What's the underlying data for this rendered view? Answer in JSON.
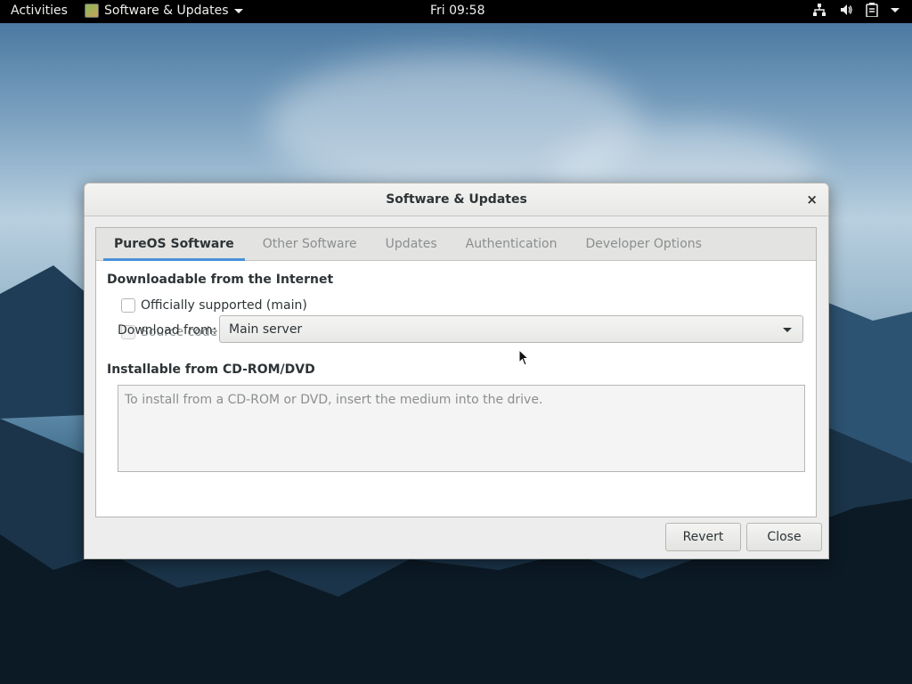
{
  "topbar": {
    "activities": "Activities",
    "app_menu": "Software & Updates",
    "clock": "Fri 09:58",
    "tray_icons": [
      "network-icon",
      "volume-icon",
      "battery-icon",
      "system-menu-arrow"
    ]
  },
  "dialog": {
    "title": "Software & Updates",
    "close_glyph": "×",
    "tabs": [
      {
        "label": "PureOS Software",
        "active": true
      },
      {
        "label": "Other Software",
        "active": false
      },
      {
        "label": "Updates",
        "active": false
      },
      {
        "label": "Authentication",
        "active": false
      },
      {
        "label": "Developer Options",
        "active": false
      }
    ],
    "internet_section": {
      "title": "Downloadable from the Internet",
      "checks": [
        {
          "label": "Officially supported (main)",
          "checked": false,
          "enabled": true
        },
        {
          "label": "Source code",
          "checked": false,
          "enabled": false
        }
      ],
      "download_from_label": "Download from:",
      "download_from_value": "Main server"
    },
    "cdrom_section": {
      "title": "Installable from CD-ROM/DVD",
      "placeholder": "To install from a CD-ROM or DVD, insert the medium into the drive."
    },
    "buttons": {
      "revert": "Revert",
      "close": "Close"
    }
  },
  "colors": {
    "accent": "#4a90d9",
    "topbar": "#000000",
    "dialog_bg": "#ededed"
  }
}
